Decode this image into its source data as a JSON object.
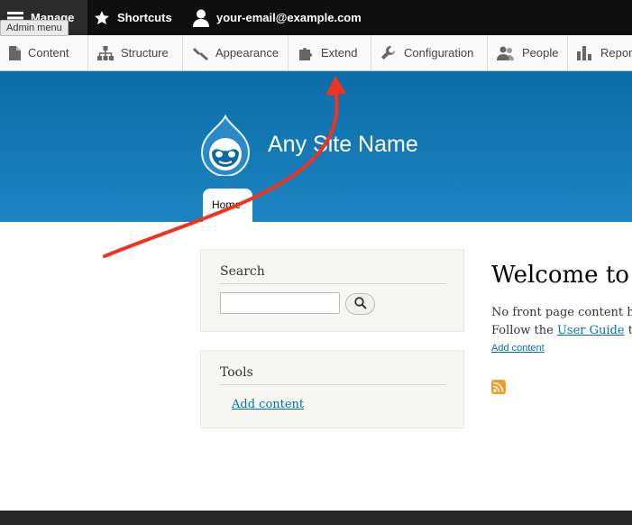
{
  "toolbar": {
    "manage_label": "Manage",
    "tooltip": "Admin menu",
    "shortcuts_label": "Shortcuts",
    "user_label": "your-email@example.com"
  },
  "tray": {
    "items": [
      {
        "label": "Content",
        "icon": "file-icon"
      },
      {
        "label": "Structure",
        "icon": "sitemap-icon"
      },
      {
        "label": "Appearance",
        "icon": "paintbrush-icon"
      },
      {
        "label": "Extend",
        "icon": "puzzle-icon"
      },
      {
        "label": "Configuration",
        "icon": "wrench-icon"
      },
      {
        "label": "People",
        "icon": "people-icon"
      },
      {
        "label": "Reports",
        "icon": "bar-chart-icon"
      }
    ]
  },
  "header": {
    "site_name": "Any Site Name",
    "home_tab": "Home"
  },
  "sidebar": {
    "search_title": "Search",
    "tools_title": "Tools",
    "tools_link": "Add content"
  },
  "main": {
    "welcome": "Welcome to A",
    "line1": "No front page content has",
    "line2_prefix": "Follow the ",
    "line2_link": "User Guide",
    "line2_suffix": " to",
    "add_content": "Add content"
  },
  "colors": {
    "header_top": "#0b6da6",
    "header_bottom": "#1d84c3",
    "link": "#0071b3",
    "annotation_arrow": "#f0321e"
  }
}
